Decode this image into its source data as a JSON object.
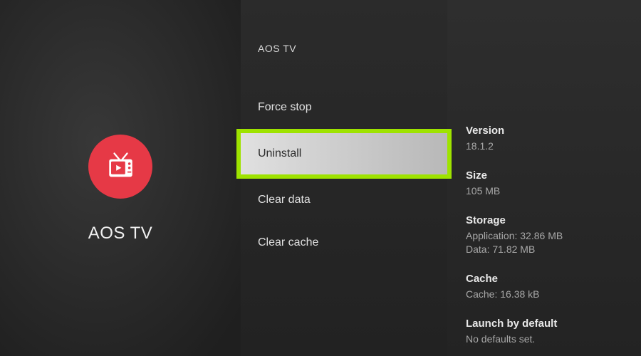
{
  "left": {
    "app_name": "AOS TV"
  },
  "middle": {
    "header": "AOS TV",
    "actions": {
      "force_stop": "Force stop",
      "uninstall": "Uninstall",
      "clear_data": "Clear data",
      "clear_cache": "Clear cache"
    }
  },
  "right": {
    "version": {
      "label": "Version",
      "value": "18.1.2"
    },
    "size": {
      "label": "Size",
      "value": "105 MB"
    },
    "storage": {
      "label": "Storage",
      "app": "Application: 32.86 MB",
      "data": "Data: 71.82 MB"
    },
    "cache": {
      "label": "Cache",
      "value": "Cache: 16.38 kB"
    },
    "launch": {
      "label": "Launch by default",
      "value": "No defaults set."
    }
  }
}
